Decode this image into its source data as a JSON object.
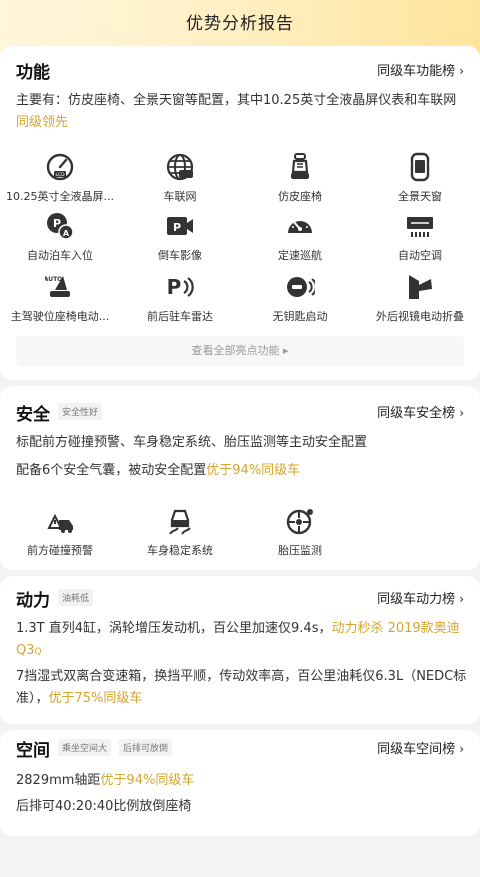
{
  "header": {
    "title": "优势分析报告"
  },
  "function": {
    "title": "功能",
    "rank_link": "同级车功能榜",
    "desc_main": "主要有：仿皮座椅、全景天窗等配置，其中10.25英寸全液晶屏仪表和车联网",
    "desc_highlight": "同级领先",
    "features": [
      {
        "label": "10.25英寸全液晶屏...",
        "icon": "lcd-gauge-icon"
      },
      {
        "label": "车联网",
        "icon": "car-globe-icon"
      },
      {
        "label": "仿皮座椅",
        "icon": "leather-seat-icon"
      },
      {
        "label": "全景天窗",
        "icon": "panoramic-roof-icon"
      },
      {
        "label": "自动泊车入位",
        "icon": "auto-parking-icon"
      },
      {
        "label": "倒车影像",
        "icon": "reverse-camera-icon"
      },
      {
        "label": "定速巡航",
        "icon": "cruise-control-icon"
      },
      {
        "label": "自动空调",
        "icon": "auto-ac-icon"
      },
      {
        "label": "主驾驶位座椅电动...",
        "icon": "power-seat-icon"
      },
      {
        "label": "前后驻车雷达",
        "icon": "parking-radar-icon"
      },
      {
        "label": "无钥匙启动",
        "icon": "keyless-start-icon"
      },
      {
        "label": "外后视镜电动折叠",
        "icon": "mirror-fold-icon"
      }
    ],
    "more_label": "查看全部亮点功能 ▸"
  },
  "safety": {
    "title": "安全",
    "tag": "安全性好",
    "rank_link": "同级车安全榜",
    "line1": "标配前方碰撞预警、车身稳定系统、胎压监测等主动安全配置",
    "line2_main": "配备6个安全气囊，被动安全配置",
    "line2_highlight": "优于94%同级车",
    "features": [
      {
        "label": "前方碰撞预警",
        "icon": "collision-warning-icon"
      },
      {
        "label": "车身稳定系统",
        "icon": "stability-control-icon"
      },
      {
        "label": "胎压监测",
        "icon": "tire-pressure-icon"
      }
    ]
  },
  "power": {
    "title": "动力",
    "tag": "油耗低",
    "rank_link": "同级车动力榜",
    "line1_main": "1.3T 直列4缸，涡轮增压发动机，百公里加速仅9.4s，",
    "line1_highlight": "动力秒杀 2019款奥迪",
    "line1_cont": "Q3",
    "line1_q": "Q",
    "line2_main": "7挡湿式双离合变速箱，换挡平顺，传动效率高，百公里油耗仅6.3L（NEDC标准），",
    "line2_highlight": "优于75%同级车"
  },
  "space": {
    "title": "空间",
    "tags": [
      "乘坐空间大",
      "后排可放倒"
    ],
    "rank_link": "同级车空间榜",
    "line1_main": "2829mm轴距",
    "line1_highlight": "优于94%同级车",
    "line2": "后排可40:20:40比例放倒座椅"
  },
  "colors": {
    "accent": "#d6a52e",
    "icon": "#333333",
    "background": "#f3f3f3"
  }
}
